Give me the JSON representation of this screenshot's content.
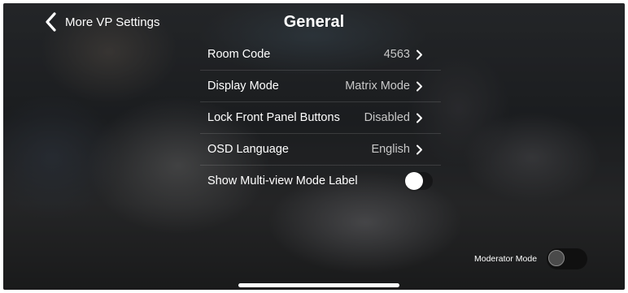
{
  "header": {
    "back_label": "More VP Settings",
    "title": "General"
  },
  "settings": [
    {
      "label": "Room Code",
      "value": "4563"
    },
    {
      "label": "Display Mode",
      "value": "Matrix Mode"
    },
    {
      "label": "Lock Front Panel Buttons",
      "value": "Disabled"
    },
    {
      "label": "OSD Language",
      "value": "English"
    }
  ],
  "multiview": {
    "label": "Show Multi-view Mode Label",
    "enabled": false
  },
  "moderator": {
    "label": "Moderator Mode",
    "enabled": false
  },
  "icons": {
    "back": "chevron-left-icon",
    "row": "chevron-right-icon"
  }
}
